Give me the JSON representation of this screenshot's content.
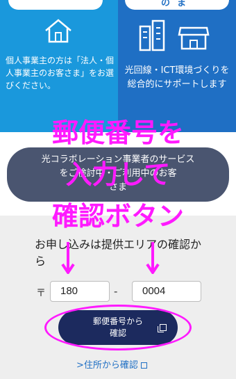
{
  "cards": {
    "left": {
      "icon": "house-icon",
      "text": "個人事業主の方は「法人・個人事業主のお客さま」をお選びください。"
    },
    "right": {
      "top_pill_text": "のま",
      "icons": [
        "building-icon",
        "shop-icon"
      ],
      "text": "光回線・ICT環境づくりを総合的にサポートします"
    }
  },
  "notice": {
    "line1": "光コラボレーション事業者のサービス",
    "line2": "をご検討中・ご利用中のお客",
    "line3": "さま"
  },
  "section": {
    "text": "お申し込みは提供エリアの確認から"
  },
  "postal": {
    "mark": "〒",
    "first": "180",
    "dash": "-",
    "second": "0004"
  },
  "search_button": {
    "line1": "郵便番号から",
    "line2": "確認"
  },
  "address_link": {
    "label": ">住所から確認"
  },
  "annotation": {
    "line1": "郵便番号を",
    "line2": "入力して",
    "line3": "確認ボタン",
    "color": "#ff1aff"
  }
}
